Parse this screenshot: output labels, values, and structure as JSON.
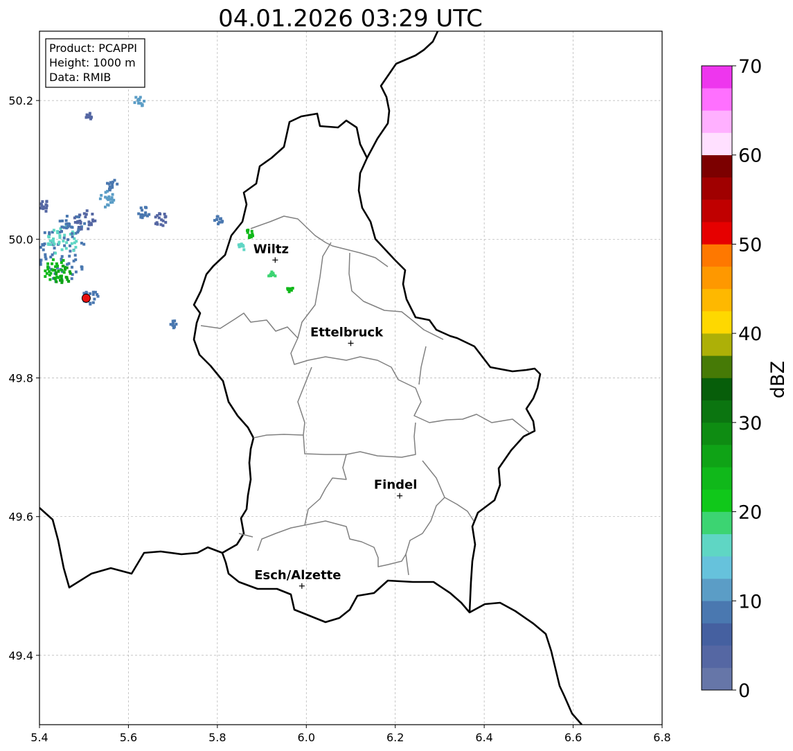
{
  "title": "04.01.2026 03:29 UTC",
  "info_box": {
    "lines": [
      "Product: PCAPPI",
      "Height: 1000 m",
      "Data: RMIB"
    ]
  },
  "map": {
    "lon_range": [
      5.4,
      6.8
    ],
    "lat_range": [
      49.3,
      50.3
    ],
    "x_ticks": [
      5.4,
      5.6,
      5.8,
      6.0,
      6.2,
      6.4,
      6.6,
      6.8
    ],
    "x_tick_labels": [
      "5.4",
      "5.6",
      "5.8",
      "6.0",
      "6.2",
      "6.4",
      "6.6",
      "6.8"
    ],
    "y_ticks": [
      49.4,
      49.6,
      49.8,
      50.0,
      50.2
    ],
    "y_tick_labels": [
      "49.4",
      "49.6",
      "49.8",
      "50.0",
      "50.2"
    ],
    "grid": true
  },
  "cities": [
    {
      "name": "Wiltz",
      "lon": 5.93,
      "lat": 49.97
    },
    {
      "name": "Ettelbruck",
      "lon": 6.1,
      "lat": 49.85
    },
    {
      "name": "Findel",
      "lon": 6.21,
      "lat": 49.63
    },
    {
      "name": "Esch/Alzette",
      "lon": 5.99,
      "lat": 49.5
    }
  ],
  "radar_site": {
    "lon": 5.505,
    "lat": 49.915,
    "color": "#e81010"
  },
  "colorbar": {
    "label": "dBZ",
    "min": 0,
    "max": 70,
    "ticks": [
      0,
      10,
      20,
      30,
      40,
      50,
      60,
      70
    ],
    "tick_labels": [
      "0",
      "10",
      "20",
      "30",
      "40",
      "50",
      "60",
      "70"
    ],
    "colors": [
      "#6676a8",
      "#5567a3",
      "#4560a0",
      "#4a78b0",
      "#5b9dc6",
      "#66c2dc",
      "#5fd6c4",
      "#3cd472",
      "#10c81a",
      "#10b81a",
      "#0fa316",
      "#0e8c12",
      "#0b7510",
      "#075e0a",
      "#467a06",
      "#adb007",
      "#fed800",
      "#feb800",
      "#fe9800",
      "#fe7800",
      "#e60000",
      "#c00000",
      "#a00000",
      "#7c0000",
      "#ffe0ff",
      "#ffb0ff",
      "#ff70ff",
      "#ee36ee"
    ]
  },
  "echoes": [
    {
      "lon": 5.44,
      "lat": 49.98,
      "size": 40,
      "color": "#4a78b0"
    },
    {
      "lon": 5.45,
      "lat": 50.0,
      "size": 22,
      "color": "#5fd6c4"
    },
    {
      "lon": 5.43,
      "lat": 49.96,
      "size": 18,
      "color": "#10b81a"
    },
    {
      "lon": 5.45,
      "lat": 49.95,
      "size": 14,
      "color": "#0fa316"
    },
    {
      "lon": 5.47,
      "lat": 50.02,
      "size": 20,
      "color": "#4a78b0"
    },
    {
      "lon": 5.5,
      "lat": 50.03,
      "size": 16,
      "color": "#5567a3"
    },
    {
      "lon": 5.51,
      "lat": 49.92,
      "size": 12,
      "color": "#4a78b0"
    },
    {
      "lon": 5.55,
      "lat": 50.06,
      "size": 12,
      "color": "#5b9dc6"
    },
    {
      "lon": 5.56,
      "lat": 50.08,
      "size": 8,
      "color": "#4a78b0"
    },
    {
      "lon": 5.63,
      "lat": 50.04,
      "size": 10,
      "color": "#4a78b0"
    },
    {
      "lon": 5.67,
      "lat": 50.03,
      "size": 10,
      "color": "#5567a3"
    },
    {
      "lon": 5.62,
      "lat": 50.2,
      "size": 8,
      "color": "#5b9dc6"
    },
    {
      "lon": 5.51,
      "lat": 50.18,
      "size": 6,
      "color": "#5567a3"
    },
    {
      "lon": 5.41,
      "lat": 50.05,
      "size": 8,
      "color": "#5567a3"
    },
    {
      "lon": 5.87,
      "lat": 50.01,
      "size": 6,
      "color": "#10b81a"
    },
    {
      "lon": 5.85,
      "lat": 49.99,
      "size": 6,
      "color": "#5fd6c4"
    },
    {
      "lon": 5.92,
      "lat": 49.95,
      "size": 5,
      "color": "#3cd472"
    },
    {
      "lon": 5.96,
      "lat": 49.93,
      "size": 5,
      "color": "#10b81a"
    },
    {
      "lon": 5.7,
      "lat": 49.88,
      "size": 6,
      "color": "#4a78b0"
    },
    {
      "lon": 5.8,
      "lat": 50.03,
      "size": 6,
      "color": "#4a78b0"
    }
  ]
}
